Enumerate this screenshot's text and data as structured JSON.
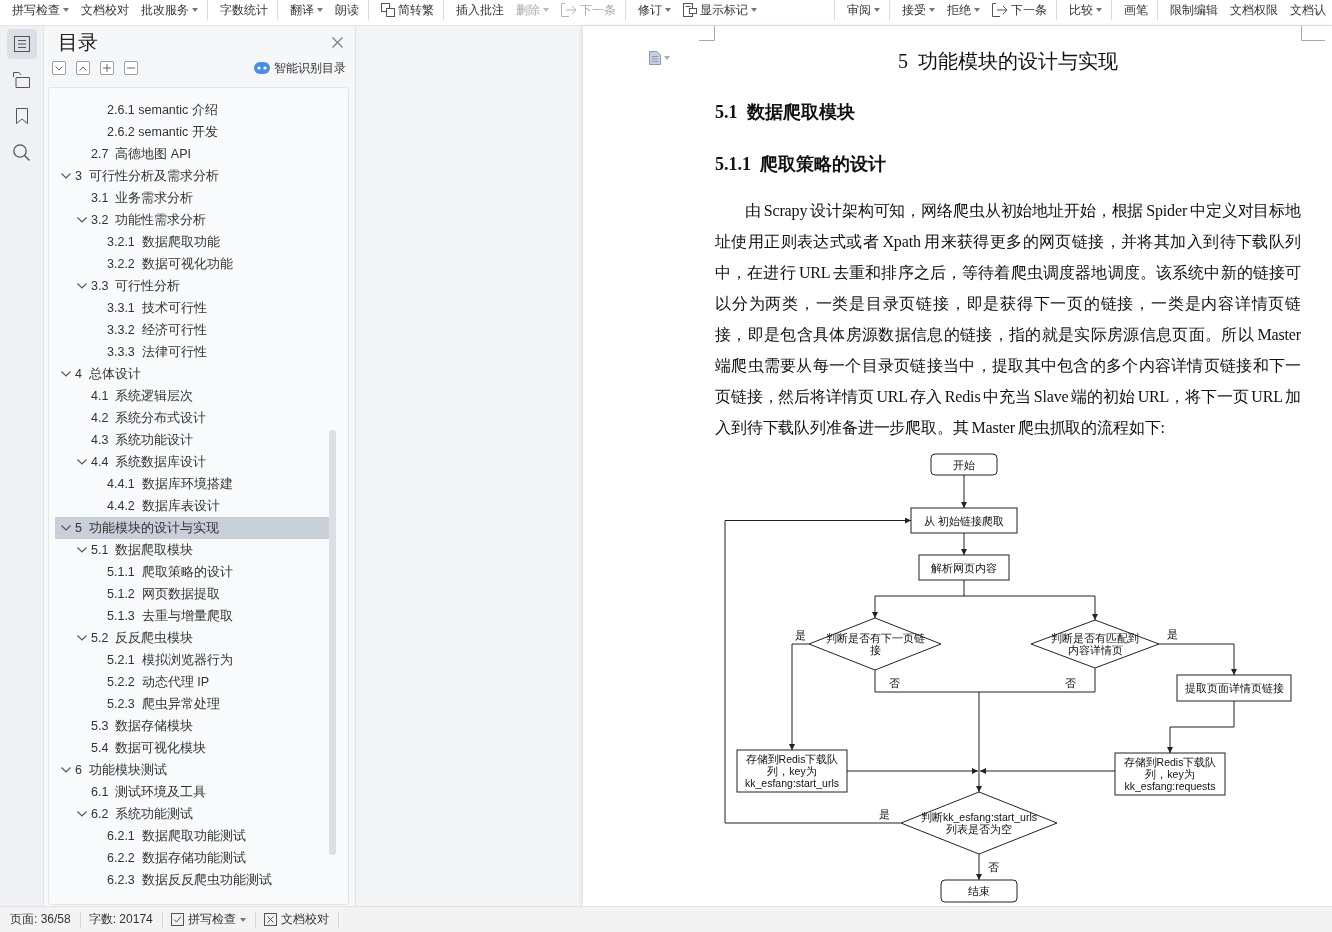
{
  "toolbar": {
    "left": [
      {
        "items": [
          {
            "kind": "text",
            "label": "拼写检查",
            "menu": true,
            "disabled": false
          },
          {
            "kind": "text",
            "label": "文档校对",
            "menu": false,
            "disabled": false
          },
          {
            "kind": "text",
            "label": "批改服务",
            "menu": true,
            "disabled": false
          }
        ]
      },
      {
        "items": [
          {
            "kind": "text",
            "label": "字数统计",
            "menu": false,
            "disabled": false
          }
        ]
      },
      {
        "items": [
          {
            "kind": "text",
            "label": "翻译",
            "menu": true,
            "disabled": false
          },
          {
            "kind": "text",
            "label": "朗读",
            "menu": false,
            "disabled": false
          }
        ]
      },
      {
        "items": [
          {
            "kind": "convert",
            "label": "简转繁",
            "menu": false,
            "disabled": false
          }
        ]
      },
      {
        "items": [
          {
            "kind": "text",
            "label": "插入批注",
            "menu": false,
            "disabled": false
          },
          {
            "kind": "text",
            "label": "删除",
            "menu": true,
            "disabled": true
          },
          {
            "kind": "next",
            "label": "下一条",
            "menu": false,
            "disabled": true
          }
        ]
      },
      {
        "items": [
          {
            "kind": "text",
            "label": "修订",
            "menu": true,
            "disabled": false
          },
          {
            "kind": "markup",
            "label": "显示标记",
            "menu": true,
            "disabled": false
          }
        ]
      }
    ],
    "right": [
      {
        "items": [
          {
            "kind": "text",
            "label": "审阅",
            "menu": true,
            "disabled": false
          }
        ]
      },
      {
        "items": [
          {
            "kind": "text",
            "label": "接受",
            "menu": true,
            "disabled": false
          },
          {
            "kind": "text",
            "label": "拒绝",
            "menu": true,
            "disabled": false
          },
          {
            "kind": "next",
            "label": "下一条",
            "menu": false,
            "disabled": false
          }
        ]
      },
      {
        "items": [
          {
            "kind": "text",
            "label": "比较",
            "menu": true,
            "disabled": false
          }
        ]
      },
      {
        "items": [
          {
            "kind": "text",
            "label": "画笔",
            "menu": false,
            "disabled": false
          }
        ]
      },
      {
        "items": [
          {
            "kind": "text",
            "label": "限制编辑",
            "menu": false,
            "disabled": false
          },
          {
            "kind": "text",
            "label": "文档权限",
            "menu": false,
            "disabled": false
          },
          {
            "kind": "text",
            "label": "文档认",
            "menu": false,
            "disabled": false
          }
        ]
      }
    ]
  },
  "rail": [
    {
      "kind": "contents",
      "selected": true
    },
    {
      "kind": "navigation",
      "selected": false
    },
    {
      "kind": "bookmark",
      "selected": false
    },
    {
      "kind": "search",
      "selected": false
    }
  ],
  "sidebar": {
    "title": "目录",
    "smart_toc": "智能识别目录",
    "toc": [
      {
        "children": [
          {
            "children": [
              {
                "label": "2.6.1 semantic 介绍",
                "selected": false
              },
              {
                "label": "2.6.2 semantic 开发",
                "selected": false
              }
            ]
          },
          {
            "label": "2.7  高德地图 API",
            "selected": false
          }
        ]
      },
      {
        "label": "3  可行性分析及需求分析",
        "selected": false,
        "expanded": true,
        "children": [
          {
            "label": "3.1  业务需求分析",
            "selected": false
          },
          {
            "label": "3.2  功能性需求分析",
            "selected": false,
            "expanded": true,
            "children": [
              {
                "label": "3.2.1  数据爬取功能",
                "selected": false
              },
              {
                "label": "3.2.2  数据可视化功能",
                "selected": false
              }
            ]
          },
          {
            "label": "3.3  可行性分析",
            "selected": false,
            "expanded": true,
            "children": [
              {
                "label": "3.3.1  技术可行性",
                "selected": false
              },
              {
                "label": "3.3.2  经济可行性",
                "selected": false
              },
              {
                "label": "3.3.3  法律可行性",
                "selected": false
              }
            ]
          }
        ]
      },
      {
        "label": "4  总体设计",
        "selected": false,
        "expanded": true,
        "children": [
          {
            "label": "4.1  系统逻辑层次",
            "selected": false
          },
          {
            "label": "4.2  系统分布式设计",
            "selected": false
          },
          {
            "label": "4.3  系统功能设计",
            "selected": false
          },
          {
            "label": "4.4  系统数据库设计",
            "selected": false,
            "expanded": true,
            "children": [
              {
                "label": "4.4.1  数据库环境搭建",
                "selected": false
              },
              {
                "label": "4.4.2  数据库表设计",
                "selected": false
              }
            ]
          }
        ]
      },
      {
        "label": "5  功能模块的设计与实现",
        "selected": true,
        "expanded": true,
        "children": [
          {
            "label": "5.1  数据爬取模块",
            "selected": false,
            "expanded": true,
            "children": [
              {
                "label": "5.1.1  爬取策略的设计",
                "selected": false
              },
              {
                "label": "5.1.2  网页数据提取",
                "selected": false
              },
              {
                "label": "5.1.3  去重与增量爬取",
                "selected": false
              }
            ]
          },
          {
            "label": "5.2  反反爬虫模块",
            "selected": false,
            "expanded": true,
            "children": [
              {
                "label": "5.2.1  模拟浏览器行为",
                "selected": false
              },
              {
                "label": "5.2.2  动态代理 IP",
                "selected": false
              },
              {
                "label": "5.2.3  爬虫异常处理",
                "selected": false
              }
            ]
          },
          {
            "label": "5.3  数据存储模块",
            "selected": false
          },
          {
            "label": "5.4  数据可视化模块",
            "selected": false
          }
        ]
      },
      {
        "label": "6  功能模块测试",
        "selected": false,
        "expanded": true,
        "children": [
          {
            "label": "6.1  测试环境及工具",
            "selected": false
          },
          {
            "label": "6.2  系统功能测试",
            "selected": false,
            "expanded": true,
            "children": [
              {
                "label": "6.2.1  数据爬取功能测试",
                "selected": false
              },
              {
                "label": "6.2.2  数据存储功能测试",
                "selected": false
              },
              {
                "label": "6.2.3  数据反反爬虫功能测试",
                "selected": false
              }
            ]
          }
        ]
      }
    ]
  },
  "document": {
    "heading": "5  功能模块的设计与实现",
    "section": "5.1  数据爬取模块",
    "subsection": "5.1.1  爬取策略的设计",
    "paragraph": "由 Scrapy 设计架构可知，网络爬虫从初始地址开始，根据 Spider 中定义对目标地址使用正则表达式或者 Xpath 用来获得更多的网页链接，并将其加入到待下载队列中，在进行 URL 去重和排序之后，等待着爬虫调度器地调度。该系统中新的链接可以分为两类，一类是目录页链接，即是获得下一页的链接，一类是内容详情页链接，即是包含具体房源数据信息的链接，指的就是实际房源信息页面。所以 Master 端爬虫需要从每一个目录页链接当中，提取其中包含的多个内容详情页链接和下一页链接，然后将详情页 URL 存入 Redis 中充当 Slave 端的初始 URL，将下一页 URL 加入到待下载队列准备进一步爬取。其 Master 爬虫抓取的流程如下:",
    "flowchart": {
      "nodes": [
        {
          "kind": "terminal",
          "text": "开始"
        },
        {
          "kind": "process",
          "text": "从 初始链接爬取"
        },
        {
          "kind": "process",
          "text": "解析网页内容"
        },
        {
          "kind": "decision",
          "text": "判断是否有下一页链接"
        },
        {
          "kind": "decision",
          "text": "判断是否有匹配到内容详情页"
        },
        {
          "kind": "process",
          "text": "提取页面详情页链接"
        },
        {
          "kind": "process",
          "text": "存储到Redis下载队列，key为kk_esfang:start_urls"
        },
        {
          "kind": "process",
          "text": "存储到Redis下载队列，key为kk_esfang:requests"
        },
        {
          "kind": "decision",
          "text": "判断kk_esfang:start_urls列表是否为空"
        },
        {
          "kind": "terminal",
          "text": "结束"
        }
      ],
      "labels": [
        "是",
        "是",
        "否",
        "否",
        "是",
        "否"
      ]
    }
  },
  "status_bar": {
    "page": "页面: 36/58",
    "words": "字数: 20174",
    "spell_check": "拼写检查",
    "proofread": "文档校对"
  }
}
